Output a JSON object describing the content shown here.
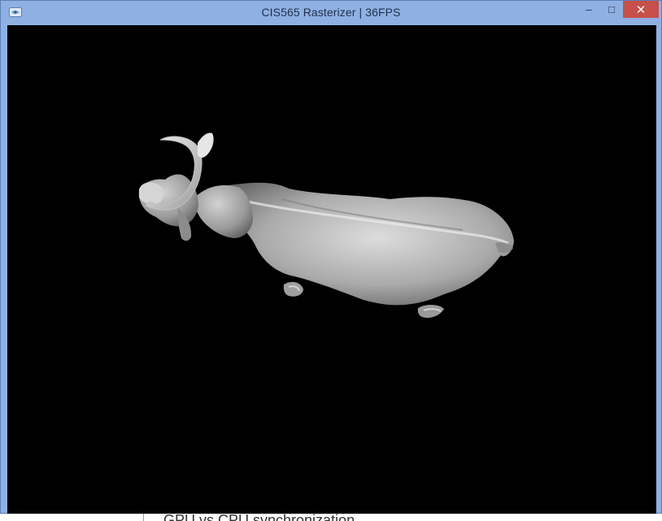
{
  "window": {
    "title": "CIS565 Rasterizer | 36FPS",
    "icon": "app-window-icon",
    "controls": {
      "minimize": "‒",
      "maximize": "□",
      "close": "✕"
    }
  },
  "viewport": {
    "background": "#000000",
    "model": "cow",
    "model_color": "#bdbdbd"
  },
  "background_app": {
    "partial_text": "GPU vs CPU synchronization"
  }
}
